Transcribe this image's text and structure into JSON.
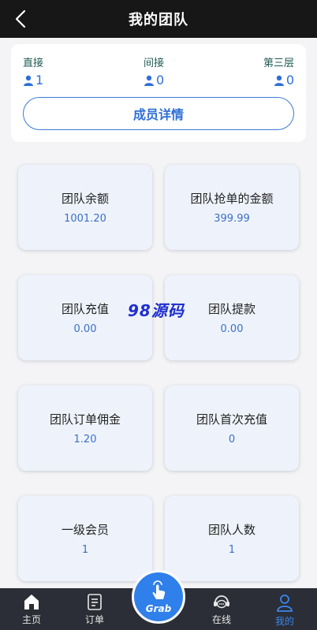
{
  "header": {
    "title": "我的团队"
  },
  "summary": {
    "direct": {
      "label": "直接",
      "count": "1"
    },
    "indirect": {
      "label": "间接",
      "count": "0"
    },
    "third": {
      "label": "第三层",
      "count": "0"
    },
    "members_button": "成员详情"
  },
  "cards": [
    {
      "label": "团队余额",
      "value": "1001.20"
    },
    {
      "label": "团队抢单的金额",
      "value": "399.99"
    },
    {
      "label": "团队充值",
      "value": "0.00"
    },
    {
      "label": "团队提款",
      "value": "0.00"
    },
    {
      "label": "团队订单佣金",
      "value": "1.20"
    },
    {
      "label": "团队首次充值",
      "value": "0"
    },
    {
      "label": "一级会员",
      "value": "1"
    },
    {
      "label": "团队人数",
      "value": "1"
    }
  ],
  "watermark": "98源码",
  "tabbar": {
    "home": "主页",
    "orders": "订单",
    "grab": "Grab",
    "online": "在线",
    "mine": "我的"
  },
  "colors": {
    "accent": "#2f80ea",
    "header_bg": "#171717",
    "card_bg": "#eef3fb"
  }
}
